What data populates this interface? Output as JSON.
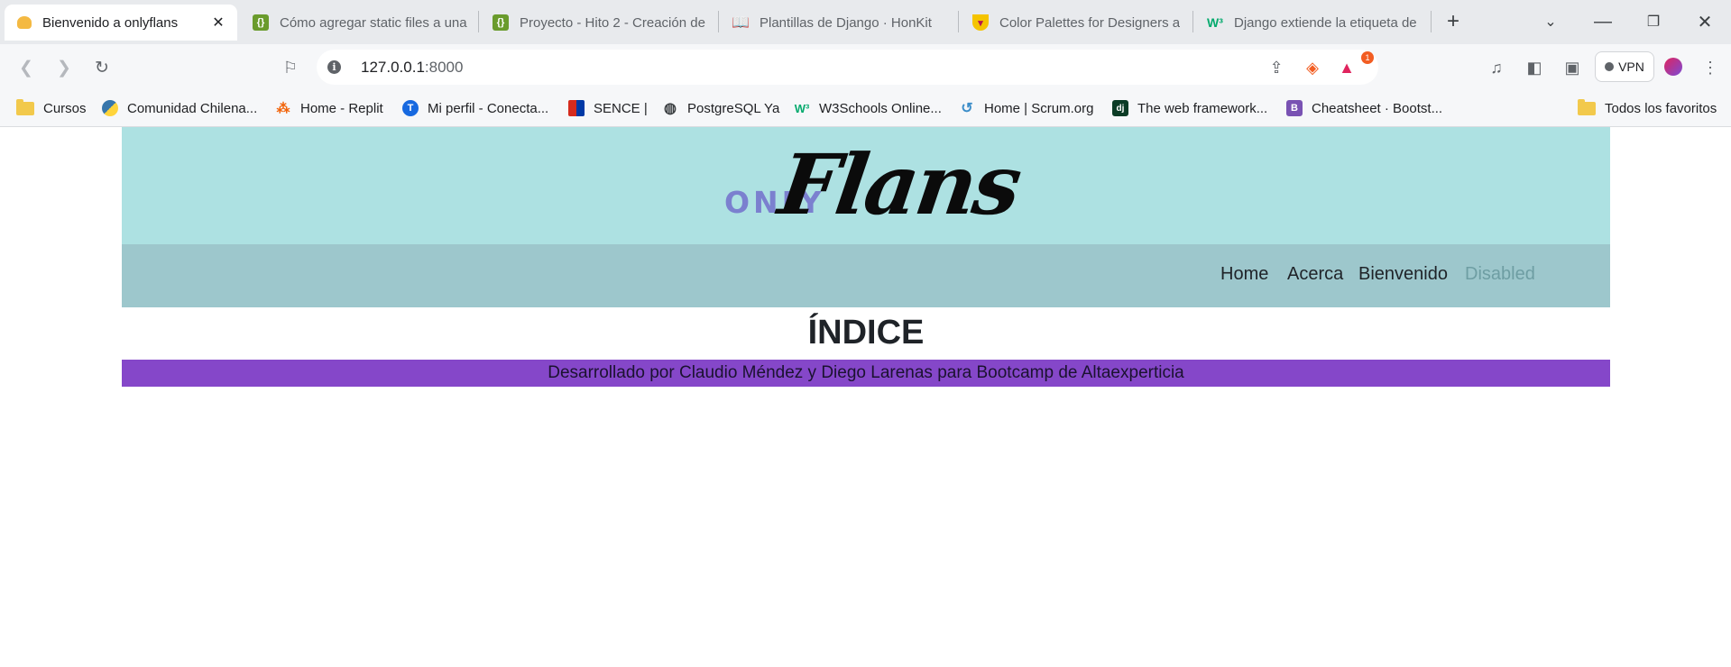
{
  "browser": {
    "tabs": [
      {
        "title": "Bienvenido a onlyflans",
        "icon": "flan-icon",
        "active": true
      },
      {
        "title": "Cómo agregar static files a una",
        "icon": "code-icon",
        "active": false
      },
      {
        "title": "Proyecto - Hito 2 - Creación de",
        "icon": "code-icon",
        "active": false
      },
      {
        "title": "Plantillas de Django · HonKit",
        "icon": "book-icon",
        "active": false
      },
      {
        "title": "Color Palettes for Designers and",
        "icon": "palette-icon",
        "active": false
      },
      {
        "title": "Django extiende la etiqueta de",
        "icon": "w3-icon",
        "active": false
      }
    ],
    "url": {
      "host": "127.0.0.1",
      "port": ":8000"
    },
    "vpn_label": "VPN",
    "brave_badge": "1",
    "bookmarks": [
      {
        "label": "Cursos",
        "icon": "folder-icon"
      },
      {
        "label": "Comunidad Chilena...",
        "icon": "python-icon"
      },
      {
        "label": "Home - Replit",
        "icon": "replit-icon"
      },
      {
        "label": "Mi perfil - Conecta...",
        "icon": "conecta-icon"
      },
      {
        "label": "SENCE |",
        "icon": "sence-icon"
      },
      {
        "label": "PostgreSQL Ya",
        "icon": "globe-icon"
      },
      {
        "label": "W3Schools Online...",
        "icon": "w3-icon"
      },
      {
        "label": "Home | Scrum.org",
        "icon": "scrum-icon"
      },
      {
        "label": "The web framework...",
        "icon": "django-icon"
      },
      {
        "label": "Cheatsheet · Bootst...",
        "icon": "bootstrap-icon"
      }
    ],
    "all_bookmarks_label": "Todos los favoritos"
  },
  "site": {
    "logo_small": "ONLY",
    "logo_big": "Flans",
    "nav": [
      {
        "label": "Home",
        "disabled": false
      },
      {
        "label": "Acerca",
        "disabled": false
      },
      {
        "label": "Bienvenido",
        "disabled": false
      },
      {
        "label": "Disabled",
        "disabled": true
      }
    ],
    "title": "ÍNDICE",
    "footer": "Desarrollado por Claudio Méndez y Diego Larenas para Bootcamp de Altaexperticia"
  },
  "colors": {
    "header_bg": "#ade1e2",
    "navbar_bg": "#9dc7cc",
    "footer_bg": "#8547c9",
    "logo_only": "#7b80cf"
  }
}
